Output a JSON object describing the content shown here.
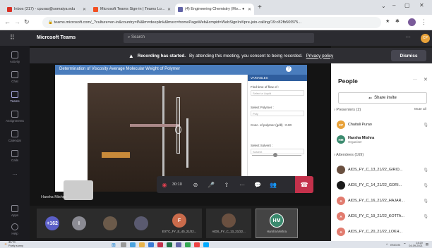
{
  "browser": {
    "tabs": [
      {
        "label": "Inbox (217) - cpurao@somaiya.edu",
        "color": "#d93025"
      },
      {
        "label": "Microsoft Teams Sign-in | Teams Lo...",
        "color": "#f25022"
      },
      {
        "label": "(4) Engineering Chemistry (Mo... ●",
        "color": "#6264a7"
      }
    ],
    "new_tab": "+",
    "url": "teams.microsoft.com/_?culture=en-in&country=IN&lm=deeplink&lmsrc=homePageWeb&cmpid=WebSignIn#/pre-join-calling/19:c82fb50f375..."
  },
  "teams": {
    "app_name": "Microsoft Teams",
    "search_placeholder": "Search",
    "rail": [
      "Activity",
      "Chat",
      "Teams",
      "Assignments",
      "Calendar",
      "Calls",
      "...",
      "Apps",
      "Help"
    ]
  },
  "banner": {
    "bold": "Recording has started.",
    "text": "By attending this meeting, you consent to being recorded.",
    "link": "Privacy policy",
    "dismiss": "Dismiss"
  },
  "shared": {
    "title": "Determination of Viscosity Average Molecular Weight of Polymer",
    "variables_header": "VARIABLES",
    "labels": [
      "Find time of flow of :",
      "Select Polymer :",
      "Conc. of polymer (g/dl) : 0.00",
      "Select Solvent :"
    ],
    "selects": [
      "Select a Liquid",
      "Poly",
      "",
      "Solvent"
    ],
    "button": "START",
    "presenter_name": "Harsha Mishra"
  },
  "controls": {
    "timer": "30:10"
  },
  "gallery": {
    "count": "+162",
    "tiles": [
      {
        "initial": "I",
        "color": "#8b8b93",
        "name": ""
      },
      {
        "initial": "",
        "color": "#6b5a4a",
        "name": ""
      },
      {
        "initial": "",
        "color": "#5a5a70",
        "name": ""
      },
      {
        "initial": "F",
        "color": "#ca6b4b",
        "name": "EXTC_FY_E_40_21/22..."
      },
      {
        "initial": "",
        "color": "#6a5040",
        "name": "AIDS_FY_C_13_21/22..."
      },
      {
        "initial": "HM",
        "color": "#3b8a6e",
        "name": "Harsha Mishra"
      }
    ]
  },
  "people": {
    "title": "People",
    "share_invite": "Share invite",
    "presenters_label": "Presenters (2)",
    "mute_all": "Mute all",
    "presenters": [
      {
        "initials": "CP",
        "name": "Chaitali Purao",
        "role": "",
        "color": "#e8a23a"
      },
      {
        "initials": "HM",
        "name": "Harsha Mishra",
        "role": "Organizer",
        "color": "#3b8a6e"
      }
    ],
    "attendees_label": "Attendees (169)",
    "attendees": [
      {
        "initials": "",
        "name": "AIDS_FY_C_13_21/22_GIRID...",
        "color": "#6a5040"
      },
      {
        "initials": "",
        "name": "AIDS_FY_C_14_21/22_GORI...",
        "color": "#1a1a1a"
      },
      {
        "initials": "A",
        "name": "AIDS_FY_C_16_21/22_HAJAR...",
        "color": "#e27c6f"
      },
      {
        "initials": "A",
        "name": "AIDS_FY_C_19_21/22_KOTTA...",
        "color": "#e27c6f"
      },
      {
        "initials": "A",
        "name": "AIDS_FY_C_20_21/22_LOKH...",
        "color": "#e27c6f"
      }
    ]
  },
  "taskbar": {
    "weather_temp": "31°C",
    "weather_desc": "Partly sunny",
    "lang": "ENG",
    "region": "IN",
    "time": "14:20",
    "date": "04-09-2021"
  }
}
